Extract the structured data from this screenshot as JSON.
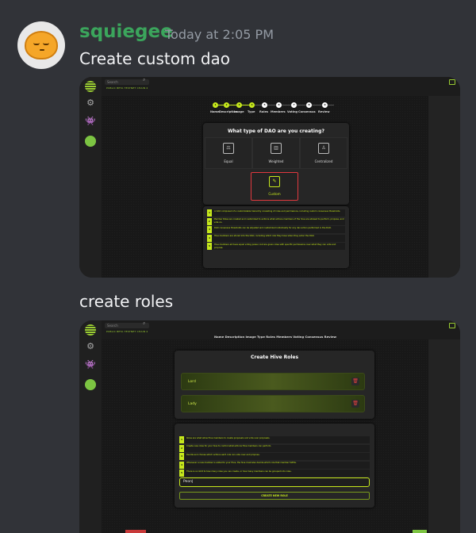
{
  "message": {
    "username": "squiegee",
    "timestamp": "Today at 2:05 PM",
    "text1": "Create custom dao",
    "text2": "create roles"
  },
  "app": {
    "search_placeholder": "Search",
    "top_note": "PUBLIC BETA TESTNET CHAIN 4"
  },
  "shot1": {
    "steps": [
      {
        "num": "1",
        "label": "Name",
        "done": true
      },
      {
        "num": "2",
        "label": "Description",
        "done": true
      },
      {
        "num": "3",
        "label": "Image",
        "done": true
      },
      {
        "num": "4",
        "label": "Type",
        "done": true
      },
      {
        "num": "5",
        "label": "Roles",
        "done": false
      },
      {
        "num": "6",
        "label": "Members",
        "done": false
      },
      {
        "num": "7",
        "label": "Voting",
        "done": false
      },
      {
        "num": "8",
        "label": "Consensus",
        "done": false
      },
      {
        "num": "9",
        "label": "Review",
        "done": false
      }
    ],
    "card_title": "What type of DAO are you creating?",
    "types": [
      "Equal",
      "Weighted",
      "Centralized"
    ],
    "custom_label": "Custom",
    "info": [
      "A DAO composed of a customizable hierarchy consisting of roles and permissions, including custom consensus thresholds.",
      "Member Roles are created and customized to enforce what actions members of the hive are allowed to perform, propose, and vote on.",
      "DAO consensus thresholds can be adjusted and customized individually for any dao action performed in the DAO.",
      "Hive members are stored into the DAO, including which role they have when they enter the DAO.",
      "Hive members all have equal voting power, but are given roles with specific permissions over what they can vote and propose."
    ]
  },
  "shot2": {
    "nav": "Name  Description  Image  Type  Roles  Members  Voting  Consensus  Review",
    "card_title": "Create Hive Roles",
    "roles": [
      "Lord",
      "Lady"
    ],
    "info": [
      "Roles are what allow Hive members to create proposals and vote over proposals.",
      "Create new roles for your hive to control what actions Hive members can perform.",
      "Decide and choose which actions each role can vote over and propose.",
      "Whenever a new member is added to your Hive, the hive must also decide which role that member fulfills.",
      "There is no limit to how many roles you can create, or how many members can be grouped into roles."
    ],
    "input_value": "Peon|",
    "create_button": "CREATE NEW ROLE"
  }
}
